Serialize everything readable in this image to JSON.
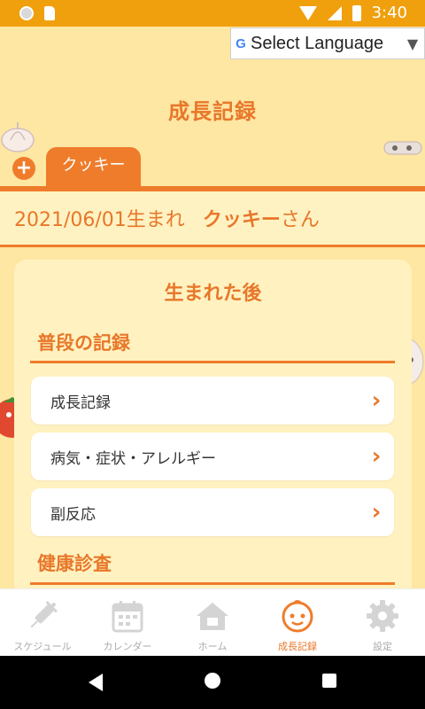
{
  "status_bar": {
    "time": "3:40"
  },
  "language_selector": {
    "label": "Select Language",
    "g_icon": "G"
  },
  "page": {
    "title": "成長記録"
  },
  "tabs": {
    "add_icon": "+",
    "active_tab": "クッキー"
  },
  "child": {
    "birth_text": "2021/06/01生まれ",
    "name": "クッキー",
    "suffix": "さん"
  },
  "card": {
    "title": "生まれた後",
    "sections": [
      {
        "title": "普段の記録",
        "items": [
          "成長記録",
          "病気・症状・アレルギー",
          "副反応"
        ]
      },
      {
        "title": "健康診査"
      }
    ]
  },
  "bottom_nav": [
    {
      "label": "スケジュール",
      "icon": "syringe-icon"
    },
    {
      "label": "カレンダー",
      "icon": "calendar-icon"
    },
    {
      "label": "ホーム",
      "icon": "house-icon"
    },
    {
      "label": "成長記録",
      "icon": "baby-face-icon",
      "active": true
    },
    {
      "label": "設定",
      "icon": "gear-icon"
    }
  ],
  "colors": {
    "accent": "#ef7c2b",
    "background": "#fee6a3",
    "status_bar": "#f0a00d",
    "card": "#fff2c0"
  }
}
